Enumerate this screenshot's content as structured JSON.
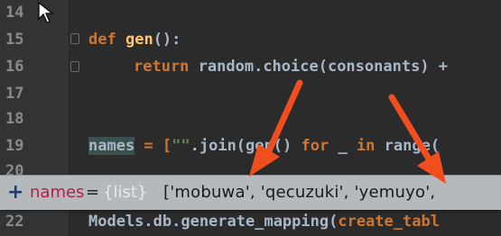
{
  "lines": [
    {
      "num": "14"
    },
    {
      "num": "15"
    },
    {
      "num": "16"
    },
    {
      "num": "17"
    },
    {
      "num": "18"
    },
    {
      "num": "19"
    },
    {
      "num": "20"
    },
    {
      "num": "22"
    }
  ],
  "code": {
    "l15_def": "def",
    "l15_name": "gen",
    "l15_rest": "():",
    "l16_return": "return",
    "l16_rest": "random.choice(consonants) +",
    "l19_names": "names",
    "l19_eq": " = [",
    "l19_str": "\"\"",
    "l19_join": ".join(gen()",
    "l19_for": "for",
    "l19_mid": "_",
    "l19_in": "in",
    "l19_range": "range(",
    "l22_text": "Models.db.generate_mapping(",
    "l22_arg": "create_tabl"
  },
  "tooltip": {
    "plus": "+",
    "variable": "names",
    "equals": "=",
    "type": "{list}",
    "value": "['mobuwa', 'qecuzuki', 'yemuyo',"
  },
  "icons": [
    "cursor-icon",
    "fold-icon",
    "expand-icon",
    "arrow-icon"
  ],
  "colors": {
    "editor_bg": "#2b2b2b",
    "keyword": "#cc7832",
    "function": "#ffc66d",
    "string": "#6a8759",
    "tooltip_bg": "#b6b9bc",
    "tooltip_var": "#b0214d",
    "arrow": "#f04e1f"
  }
}
